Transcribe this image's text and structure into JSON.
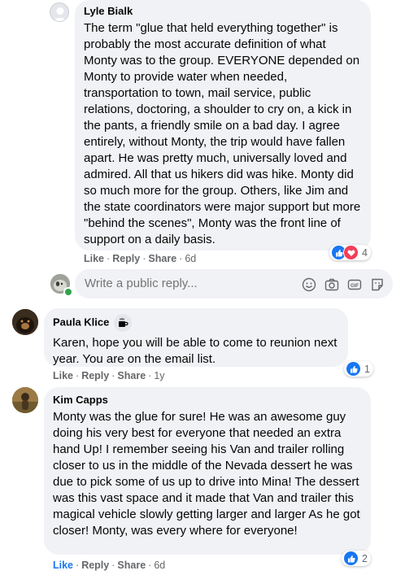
{
  "comments": [
    {
      "author": "Lyle Bialk",
      "text": "The term \"glue that held everything together\" is probably the most accurate definition of what Monty was to the group. EVERYONE depended on Monty to provide water when needed, transportation to town, mail service, public relations, doctoring, a shoulder to cry on, a kick in the pants, a friendly smile on a bad day. I agree entirely, without Monty, the trip would have fallen apart. He was pretty much, universally loved and admired. All that us hikers did was hike. Monty did so much more for the group. Others, like Jim and the state coordinators were major support but more \"behind the scenes\", Monty was the front line of support on a daily basis.",
      "like": "Like",
      "reply": "Reply",
      "share": "Share",
      "time": "6d",
      "reactions": "4"
    },
    {
      "author": "Paula Klice",
      "badge_icon": "coffee-mug-icon",
      "text": "Karen, hope you will be able to come to reunion next year. You are on the email list.",
      "like": "Like",
      "reply": "Reply",
      "share": "Share",
      "time": "1y",
      "reactions": "1"
    },
    {
      "author": "Kim Capps",
      "text": "Monty was the glue for sure! He was an awesome guy doing his very best for everyone that needed an extra hand Up! I remember seeing his Van and trailer rolling closer to us in the middle of the Nevada dessert he was due to pick some of us up to drive into Mina! The dessert was this vast space and it made that Van and trailer this magical vehicle slowly getting larger and larger As he got closer! Monty, was every where for everyone!",
      "like": "Like",
      "reply": "Reply",
      "share": "Share",
      "time": "6d",
      "reactions": "2"
    }
  ],
  "reply_box": {
    "placeholder": "Write a public reply..."
  },
  "colors": {
    "like_blue": "#1877f2",
    "love_red": "#f33e58",
    "bubble": "#f0f2f5",
    "meta_gray": "#65676b"
  }
}
